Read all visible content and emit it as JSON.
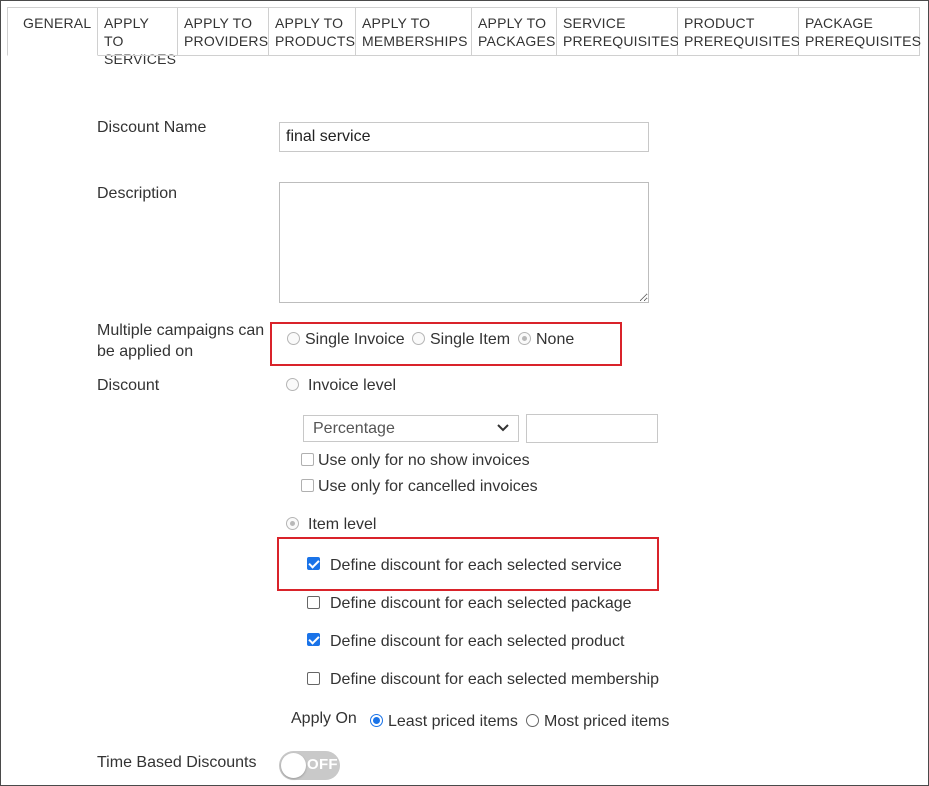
{
  "tabs": [
    {
      "label": "GENERAL",
      "active": true
    },
    {
      "label": "APPLY TO\nSERVICES"
    },
    {
      "label": "APPLY TO\nPROVIDERS"
    },
    {
      "label": "APPLY TO\nPRODUCTS"
    },
    {
      "label": "APPLY TO\nMEMBERSHIPS"
    },
    {
      "label": "APPLY TO\nPACKAGES"
    },
    {
      "label": "SERVICE\nPREREQUISITES"
    },
    {
      "label": "PRODUCT\nPREREQUISITES"
    },
    {
      "label": "PACKAGE\nPREREQUISITES"
    }
  ],
  "form": {
    "discount_name_label": "Discount Name",
    "discount_name_value": "final service",
    "description_label": "Description",
    "description_value": "",
    "multiple_campaigns_label_line1": "Multiple campaigns can",
    "multiple_campaigns_label_line2": "be applied on",
    "campaign_options": [
      "Single Invoice",
      "Single Item",
      "None"
    ],
    "campaign_selected": "None",
    "discount_label": "Discount",
    "invoice_level_label": "Invoice level",
    "discount_type_selected": "Percentage",
    "discount_amount_value": "",
    "no_show_label": "Use only for no show invoices",
    "cancelled_label": "Use only for cancelled invoices",
    "item_level_label": "Item level",
    "item_options": [
      {
        "label": "Define discount for each selected service",
        "checked": true
      },
      {
        "label": "Define discount for each selected package",
        "checked": false
      },
      {
        "label": "Define discount for each selected product",
        "checked": true
      },
      {
        "label": "Define discount for each selected membership",
        "checked": false
      }
    ],
    "apply_on_label": "Apply On",
    "apply_on_options": [
      "Least priced items",
      "Most priced items"
    ],
    "apply_on_selected": "Least priced items",
    "time_based_label": "Time Based Discounts",
    "time_based_toggle": "OFF"
  },
  "colors": {
    "accent": "#1a73e8",
    "highlight_box": "#d9232a",
    "border": "#d0d0d0"
  }
}
